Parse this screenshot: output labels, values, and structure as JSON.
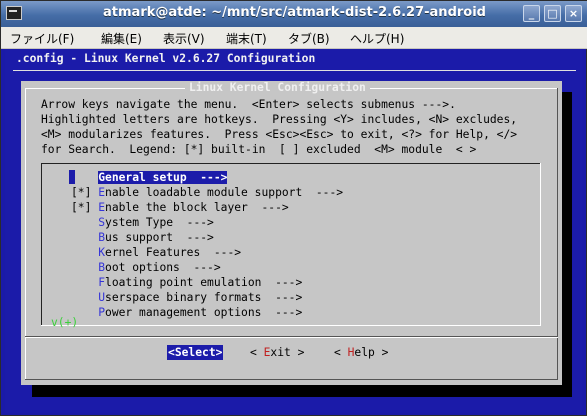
{
  "window": {
    "title": "atmark@atde: ~/mnt/src/atmark-dist-2.6.27-android",
    "minimize": "_",
    "maximize": "□",
    "close": "×"
  },
  "menubar": [
    {
      "label": "ファイル(F)"
    },
    {
      "label": "編集(E)"
    },
    {
      "label": "表示(V)"
    },
    {
      "label": "端末(T)"
    },
    {
      "label": "タブ(B)"
    },
    {
      "label": "ヘルプ(H)"
    }
  ],
  "terminal": {
    "header": ".config - Linux Kernel v2.6.27 Configuration",
    "dialog_title": "Linux Kernel Configuration",
    "help_lines": [
      "Arrow keys navigate the menu.  <Enter> selects submenus --->.",
      "Highlighted letters are hotkeys.  Pressing <Y> includes, <N> excludes,",
      "<M> modularizes features.  Press <Esc><Esc> to exit, <?> for Help, </>",
      "for Search.  Legend: [*] built-in  [ ] excluded  <M> module  < >"
    ],
    "menu_items": [
      {
        "prefix": "    ",
        "hotkey": "G",
        "rest": "eneral setup  --->",
        "selected": true
      },
      {
        "prefix": "[*] ",
        "hotkey": "E",
        "rest": "nable loadable module support  --->",
        "selected": false
      },
      {
        "prefix": "[*] ",
        "hotkey": "E",
        "rest": "nable the block layer  --->",
        "selected": false
      },
      {
        "prefix": "    ",
        "hotkey": "S",
        "rest": "ystem Type  --->",
        "selected": false
      },
      {
        "prefix": "    ",
        "hotkey": "B",
        "rest": "us support  --->",
        "selected": false
      },
      {
        "prefix": "    ",
        "hotkey": "K",
        "rest": "ernel Features  --->",
        "selected": false
      },
      {
        "prefix": "    ",
        "hotkey": "B",
        "rest": "oot options  --->",
        "selected": false
      },
      {
        "prefix": "    ",
        "hotkey": "F",
        "rest": "loating point emulation  --->",
        "selected": false
      },
      {
        "prefix": "    ",
        "hotkey": "U",
        "rest": "serspace binary formats  --->",
        "selected": false
      },
      {
        "prefix": "    ",
        "hotkey": "P",
        "rest": "ower management options  --->",
        "selected": false
      }
    ],
    "scroll_indicator": "v(+)",
    "buttons": [
      {
        "open": "<",
        "hotkey": "S",
        "rest": "elect",
        "close": ">",
        "selected": true
      },
      {
        "open": "< ",
        "hotkey": "E",
        "rest": "xit",
        "close": " >",
        "selected": false
      },
      {
        "open": "< ",
        "hotkey": "H",
        "rest": "elp",
        "close": " >",
        "selected": false
      }
    ]
  },
  "colors": {
    "terminal_bg": "#1b1ba9",
    "dialog_bg": "#c6c6c6",
    "hotkey_menu": "#3434d8",
    "hotkey_button": "#c02020",
    "scroll_indicator": "#3bd03b"
  }
}
